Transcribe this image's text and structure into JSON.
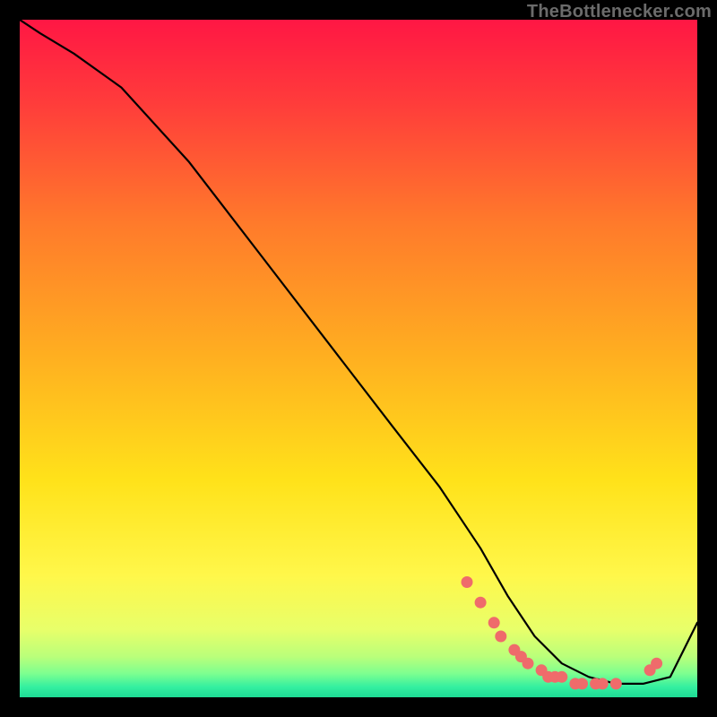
{
  "attribution": "TheBottlenecker.com",
  "chart_data": {
    "type": "line",
    "title": "",
    "xlabel": "",
    "ylabel": "",
    "xlim": [
      0,
      100
    ],
    "ylim": [
      0,
      100
    ],
    "grid": false,
    "background_gradient": {
      "stops": [
        {
          "offset": 0.0,
          "color": "#ff1744"
        },
        {
          "offset": 0.12,
          "color": "#ff3b3b"
        },
        {
          "offset": 0.3,
          "color": "#ff7a2b"
        },
        {
          "offset": 0.5,
          "color": "#ffb020"
        },
        {
          "offset": 0.68,
          "color": "#ffe21a"
        },
        {
          "offset": 0.82,
          "color": "#fff74a"
        },
        {
          "offset": 0.9,
          "color": "#e8ff6a"
        },
        {
          "offset": 0.94,
          "color": "#baff7a"
        },
        {
          "offset": 0.965,
          "color": "#7dff90"
        },
        {
          "offset": 0.985,
          "color": "#33efa0"
        },
        {
          "offset": 1.0,
          "color": "#1edb95"
        }
      ]
    },
    "series": [
      {
        "name": "curve",
        "type": "line",
        "stroke": "#000000",
        "x": [
          0,
          3,
          8,
          15,
          25,
          35,
          45,
          55,
          62,
          68,
          72,
          76,
          80,
          84,
          88,
          92,
          96,
          100
        ],
        "y": [
          100,
          98,
          95,
          90,
          79,
          66,
          53,
          40,
          31,
          22,
          15,
          9,
          5,
          3,
          2,
          2,
          3,
          11
        ]
      },
      {
        "name": "markers",
        "type": "scatter",
        "color": "#ef6b6b",
        "x": [
          66,
          68,
          70,
          71,
          73,
          74,
          75,
          77,
          78,
          79,
          80,
          82,
          83,
          85,
          86,
          88,
          93,
          94
        ],
        "y": [
          17,
          14,
          11,
          9,
          7,
          6,
          5,
          4,
          3,
          3,
          3,
          2,
          2,
          2,
          2,
          2,
          4,
          5
        ]
      }
    ]
  }
}
